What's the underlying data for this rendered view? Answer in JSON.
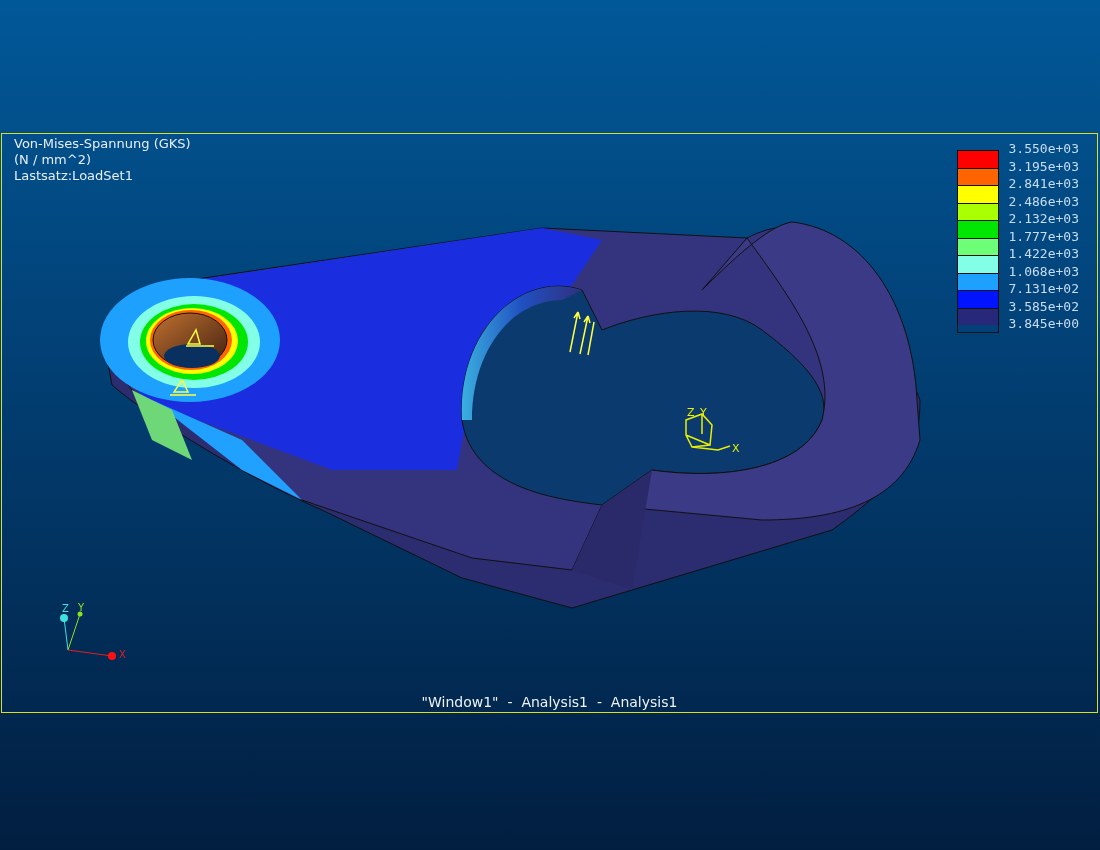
{
  "viewport": {
    "title_lines": [
      "Von-Mises-Spannung (GKS)",
      "(N / mm^2)",
      "Lastsatz:LoadSet1"
    ],
    "legend": {
      "bands": [
        {
          "color": "#ff0000"
        },
        {
          "color": "#ff6400"
        },
        {
          "color": "#ffff00"
        },
        {
          "color": "#aaff00"
        },
        {
          "color": "#00e600"
        },
        {
          "color": "#6eff78"
        },
        {
          "color": "#82ffe6"
        },
        {
          "color": "#1ea0ff"
        },
        {
          "color": "#0014ff"
        },
        {
          "color": "#28287a"
        }
      ],
      "values": [
        "3.550e+03",
        "3.195e+03",
        "2.841e+03",
        "2.486e+03",
        "2.132e+03",
        "1.777e+03",
        "1.422e+03",
        "1.068e+03",
        "7.131e+02",
        "3.585e+02",
        "3.845e+00"
      ]
    },
    "global_triad": {
      "labels": [
        "Z",
        "Y",
        "X"
      ]
    },
    "model_triad": {
      "labels": [
        "Z",
        "Y",
        "X"
      ]
    },
    "footer": "\"Window1\"  -  Analysis1  -  Analysis1"
  }
}
